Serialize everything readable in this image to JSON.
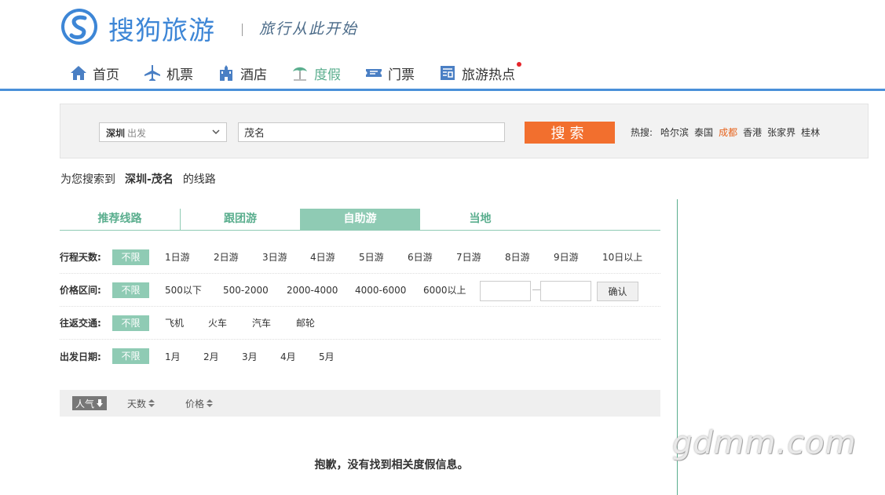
{
  "header": {
    "brand": "搜狗旅游",
    "slogan": "旅行从此开始"
  },
  "nav": [
    {
      "label": "首页",
      "icon": "home-icon"
    },
    {
      "label": "机票",
      "icon": "airplane-icon"
    },
    {
      "label": "酒店",
      "icon": "hotel-icon"
    },
    {
      "label": "度假",
      "icon": "beach-icon",
      "active": true
    },
    {
      "label": "门票",
      "icon": "ticket-icon"
    },
    {
      "label": "旅游热点",
      "icon": "news-icon"
    }
  ],
  "search": {
    "city": "深圳",
    "city_suffix": "出发",
    "destination": "茂名",
    "button": "搜索",
    "hot_label": "热搜:",
    "hot_items": [
      "哈尔滨",
      "泰国",
      "成都",
      "香港",
      "张家界",
      "桂林"
    ],
    "hot_active": "成都"
  },
  "result": {
    "prefix": "为您搜索到",
    "route": "深圳-茂名",
    "suffix": "的线路"
  },
  "tabs": [
    "推荐线路",
    "跟团游",
    "自助游",
    "当地"
  ],
  "filters": {
    "days": {
      "label": "行程天数:",
      "all": "不限",
      "options": [
        "1日游",
        "2日游",
        "3日游",
        "4日游",
        "5日游",
        "6日游",
        "7日游",
        "8日游",
        "9日游",
        "10日以上"
      ]
    },
    "price": {
      "label": "价格区间:",
      "all": "不限",
      "options": [
        "500以下",
        "500-2000",
        "2000-4000",
        "4000-6000",
        "6000以上"
      ],
      "confirm": "确认"
    },
    "transport": {
      "label": "往返交通:",
      "all": "不限",
      "options": [
        "飞机",
        "火车",
        "汽车",
        "邮轮"
      ]
    },
    "date": {
      "label": "出发日期:",
      "all": "不限",
      "options": [
        "1月",
        "2月",
        "3月",
        "4月",
        "5月"
      ]
    }
  },
  "sort": [
    "人气",
    "天数",
    "价格"
  ],
  "empty_message": "抱歉，没有找到相关度假信息。",
  "watermark": "gdmm.com",
  "colors": {
    "accent": "#8fcbb4",
    "brand": "#3d86d6",
    "search": "#f26f2e",
    "hot": "#e6641e"
  }
}
